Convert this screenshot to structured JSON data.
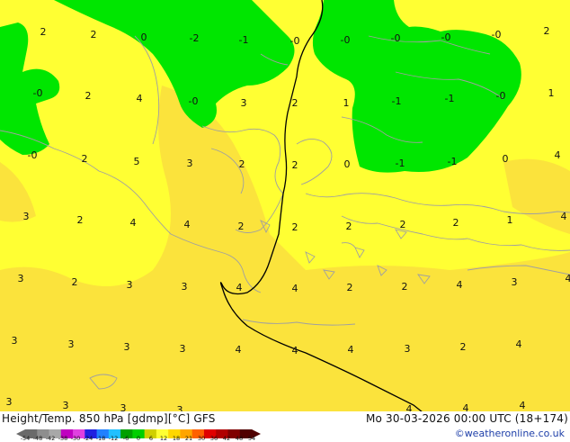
{
  "title": "Height/Temp. 850 hPa [gdmp][°C] GFS",
  "datetime": "Mo 30-03-2026 00:00 UTC (18+174)",
  "credit": "©weatheronline.co.uk",
  "colors": {
    "cold_green": "#00e600",
    "mild_yellow": "#ffff33",
    "warm_yellow": "#fbe33c",
    "coastline": "#a0a0a0",
    "contour": "#000000"
  },
  "temperature_labels": [
    "2",
    "2",
    "0",
    "-2",
    "-1",
    "-0",
    "-0",
    "-0",
    "-0",
    "-0",
    "2",
    "-0",
    "2",
    "4",
    "-0",
    "3",
    "2",
    "1",
    "-1",
    "-1",
    "-0",
    "1",
    "-0",
    "2",
    "5",
    "3",
    "2",
    "2",
    "0",
    "-1",
    "-1",
    "0",
    "4",
    "3",
    "2",
    "4",
    "4",
    "2",
    "2",
    "2",
    "2",
    "2",
    "1",
    "4",
    "3",
    "2",
    "3",
    "3",
    "4",
    "4",
    "2",
    "2",
    "4",
    "3",
    "4",
    "3",
    "3",
    "3",
    "3",
    "4",
    "4",
    "4",
    "3",
    "2",
    "4",
    "3",
    "3",
    "3",
    "3",
    "4",
    "4",
    "4"
  ],
  "colorbar": {
    "ticks": [
      "-54",
      "-48",
      "-42",
      "-38",
      "-30",
      "-24",
      "-18",
      "-12",
      "-6",
      "0",
      "6",
      "12",
      "18",
      "21",
      "30",
      "36",
      "42",
      "48",
      "54"
    ],
    "colors": [
      "#6a6a6a",
      "#8e8e8e",
      "#a8a8a8",
      "#c000c0",
      "#e040e0",
      "#2020e0",
      "#2080ff",
      "#20c0ff",
      "#00a000",
      "#00d000",
      "#d0d000",
      "#ffff33",
      "#ffd700",
      "#ffa500",
      "#ff6000",
      "#e00000",
      "#b00000",
      "#800000",
      "#500000"
    ]
  }
}
